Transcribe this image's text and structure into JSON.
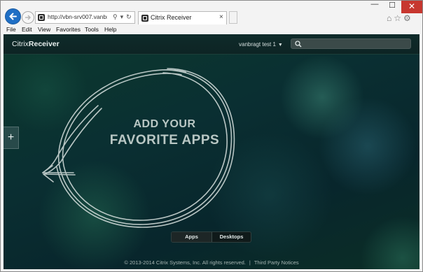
{
  "browser": {
    "address": "http://vbn-srv007.vanbra...",
    "address_icons": {
      "search": "⚲",
      "dropdown": "▾",
      "refresh": "↻"
    },
    "tab_title": "Citrix Receiver",
    "tab_close": "×",
    "window_controls": {
      "minimize": "—",
      "maximize": "☐",
      "close": "✕"
    },
    "tool_icons": [
      "home-icon",
      "star-icon",
      "gear-icon"
    ]
  },
  "menu": [
    "File",
    "Edit",
    "View",
    "Favorites",
    "Tools",
    "Help"
  ],
  "receiver": {
    "brand_light": "Citrix",
    "brand_bold": "Receiver",
    "user_name": "vanbragt test 1",
    "add_button": "+",
    "headline_line1": "ADD YOUR",
    "headline_line2": "FAVORITE APPS",
    "tabs": [
      "Apps",
      "Desktops"
    ],
    "footer_copyright": "© 2013-2014 Citrix Systems, Inc. All rights reserved.",
    "footer_separator": "|",
    "footer_link": "Third Party Notices"
  },
  "colors": {
    "accent_blue": "#1f6fc5",
    "close_red": "#c7372f",
    "background_green": "#0c3a2e"
  }
}
